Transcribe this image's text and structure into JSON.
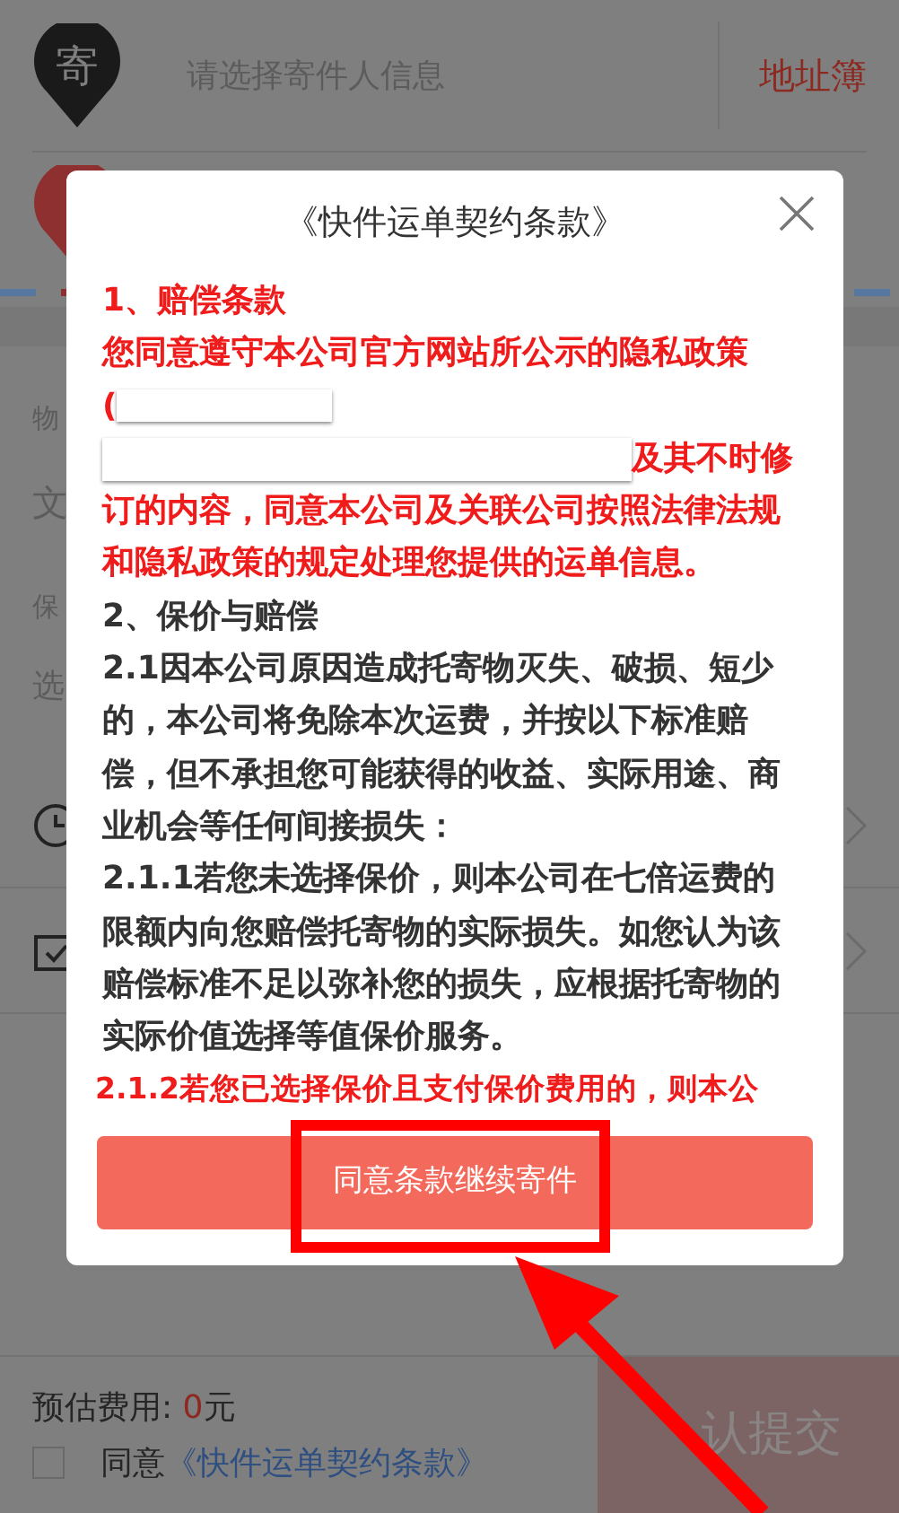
{
  "sender": {
    "pin_label": "寄",
    "placeholder": "请选择寄件人信息",
    "address_book": "地址簿"
  },
  "behind_fragments": [
    {
      "text": "物"
    },
    {
      "text": "文"
    },
    {
      "text": "保"
    },
    {
      "text": "选"
    }
  ],
  "modal": {
    "title": "《快件运单契约条款》",
    "sections": [
      {
        "kind": "text",
        "color": "#f01c1c",
        "text": "1、赔偿条款"
      },
      {
        "kind": "redacted",
        "color": "#f01c1c",
        "before": "您同意遵守本公司官方网站所公示的隐私政策",
        "bracket": "(",
        "after_inline": "及其不时修",
        "after": "订的内容，同意本公司及关联公司按照法律法规和隐私政策的规定处理您提供的运单信息。"
      },
      {
        "kind": "text",
        "color": "#333333",
        "text": "2、保价与赔偿"
      },
      {
        "kind": "text",
        "color": "#333333",
        "text": "2.1因本公司原因造成托寄物灭失、破损、短少的，本公司将免除本次运费，并按以下标准赔偿，但不承担您可能获得的收益、实际用途、商业机会等任何间接损失："
      },
      {
        "kind": "text",
        "color": "#333333",
        "text": "2.1.1若您未选择保价，则本公司在七倍运费的限额内向您赔偿托寄物的实际损失。如您认为该赔偿标准不足以弥补您的损失，应根据托寄物的实际价值选择等值保价服务。"
      },
      {
        "kind": "text",
        "color": "#f01c1c",
        "text": "2.1.2若您已选择保价且支付保价费用的，则本公"
      }
    ],
    "button": "同意条款继续寄件"
  },
  "footer": {
    "estimate_label": "预估费用: ",
    "estimate_value": "0",
    "estimate_unit": "元",
    "agree": {
      "checked": false,
      "label": "同意",
      "link": "《快件运单契约条款》"
    },
    "submit": "认提交"
  }
}
